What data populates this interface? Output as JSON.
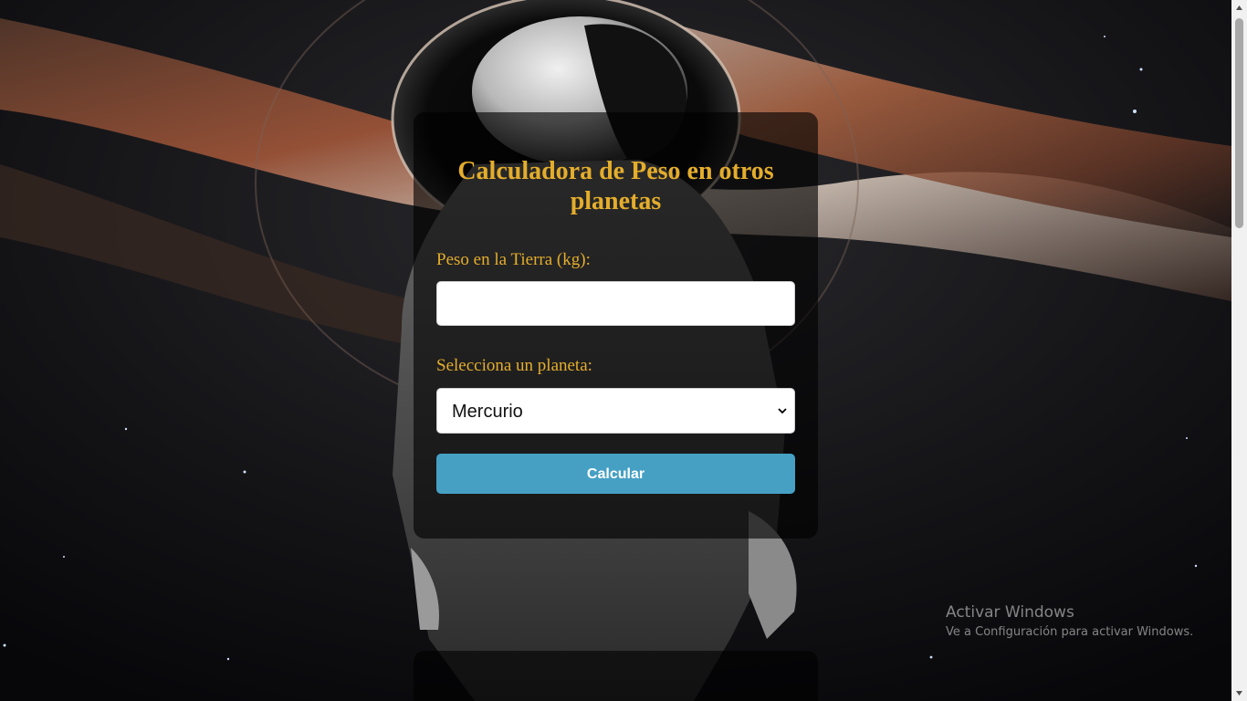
{
  "calculator": {
    "title": "Calculadora de Peso en otros planetas",
    "weight_label": "Peso en la Tierra (kg):",
    "weight_value": "",
    "planet_label": "Selecciona un planeta:",
    "planet_selected": "Mercurio",
    "calculate_button": "Calcular"
  },
  "windows_watermark": {
    "title": "Activar Windows",
    "subtitle": "Ve a Configuración para activar Windows."
  },
  "colors": {
    "title_label": "#e4ad2c",
    "button": "#46a0c4"
  },
  "icons": {
    "select_arrow": "chevron-down-icon",
    "scroll_up": "triangle-up-icon",
    "scroll_down": "triangle-down-icon"
  }
}
